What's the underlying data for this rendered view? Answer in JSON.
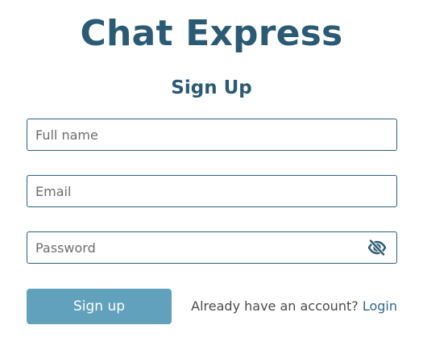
{
  "app": {
    "title": "Chat Express"
  },
  "form": {
    "title": "Sign Up",
    "fields": {
      "full_name": {
        "placeholder": "Full name",
        "value": ""
      },
      "email": {
        "placeholder": "Email",
        "value": ""
      },
      "password": {
        "placeholder": "Password",
        "value": "",
        "toggle_icon": "eye-slash-icon"
      }
    },
    "submit_label": "Sign up",
    "login_prompt": "Already have an account?",
    "login_link_label": "Login"
  },
  "colors": {
    "brand": "#2b5a74",
    "button": "#62a1bc",
    "link": "#2d6a8c",
    "input_border": "#2d5f7a"
  }
}
